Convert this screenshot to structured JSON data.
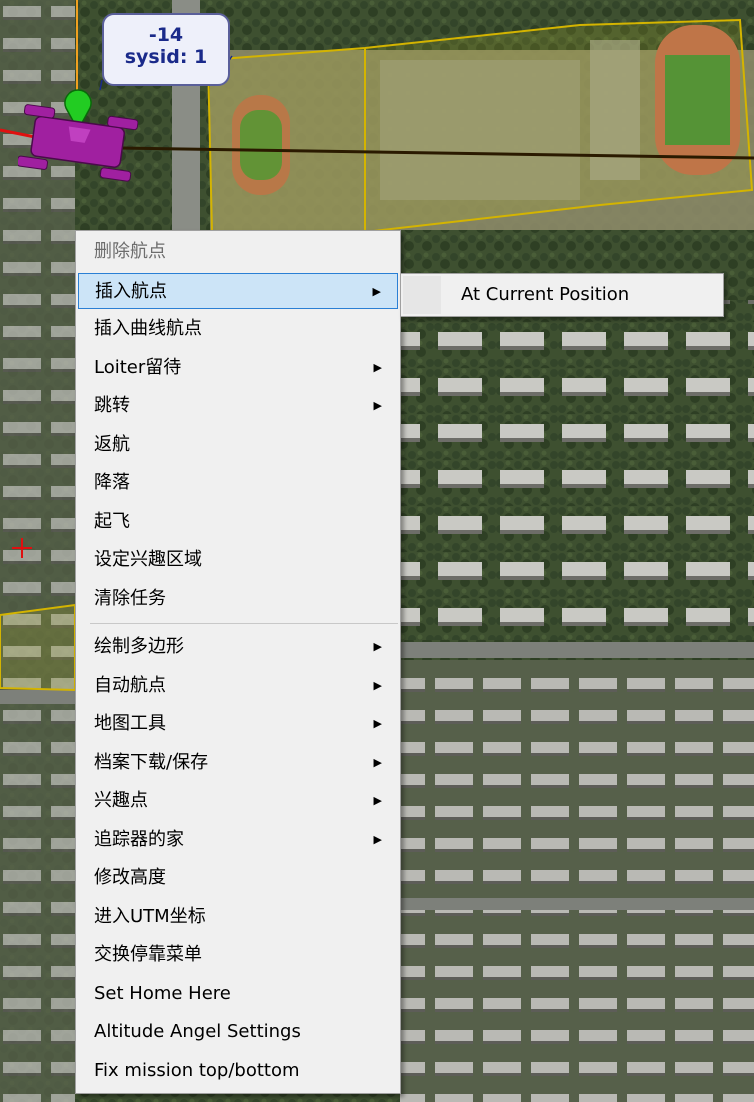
{
  "vehicle": {
    "altitude_label": "-14",
    "sysid_label": "sysid: 1"
  },
  "colors": {
    "vehicle_body": "#a020a0",
    "home_marker": "#22cc22",
    "geofence": "#d4b400",
    "track_line": "#2a1a00",
    "heading_line": "#e01010",
    "label_text": "#1a2a8a",
    "menu_highlight": "#cce4f7"
  },
  "context_menu": {
    "items": [
      {
        "label": "删除航点",
        "disabled": true,
        "submenu": false
      },
      {
        "label": "插入航点",
        "highlighted": true,
        "submenu": true
      },
      {
        "label": "插入曲线航点",
        "submenu": false
      },
      {
        "label": "Loiter留待",
        "submenu": true
      },
      {
        "label": "跳转",
        "submenu": true
      },
      {
        "label": "返航",
        "submenu": false
      },
      {
        "label": "降落",
        "submenu": false
      },
      {
        "label": "起飞",
        "submenu": false
      },
      {
        "label": "设定兴趣区域",
        "submenu": false
      },
      {
        "label": "清除任务",
        "submenu": false
      },
      {
        "label": "绘制多边形",
        "submenu": true
      },
      {
        "label": "自动航点",
        "submenu": true
      },
      {
        "label": "地图工具",
        "submenu": true
      },
      {
        "label": "档案下载/保存",
        "submenu": true
      },
      {
        "label": "兴趣点",
        "submenu": true
      },
      {
        "label": "追踪器的家",
        "submenu": true
      },
      {
        "label": "修改高度",
        "submenu": false
      },
      {
        "label": "进入UTM坐标",
        "submenu": false
      },
      {
        "label": "交换停靠菜单",
        "submenu": false
      },
      {
        "label": "Set Home Here",
        "submenu": false
      },
      {
        "label": "Altitude Angel Settings",
        "submenu": false
      },
      {
        "label": "Fix mission top/bottom",
        "submenu": false
      }
    ],
    "submenu_arrow_icon": "triangle-right-icon"
  },
  "submenu": {
    "items": [
      {
        "label": "At Current Position"
      }
    ]
  }
}
